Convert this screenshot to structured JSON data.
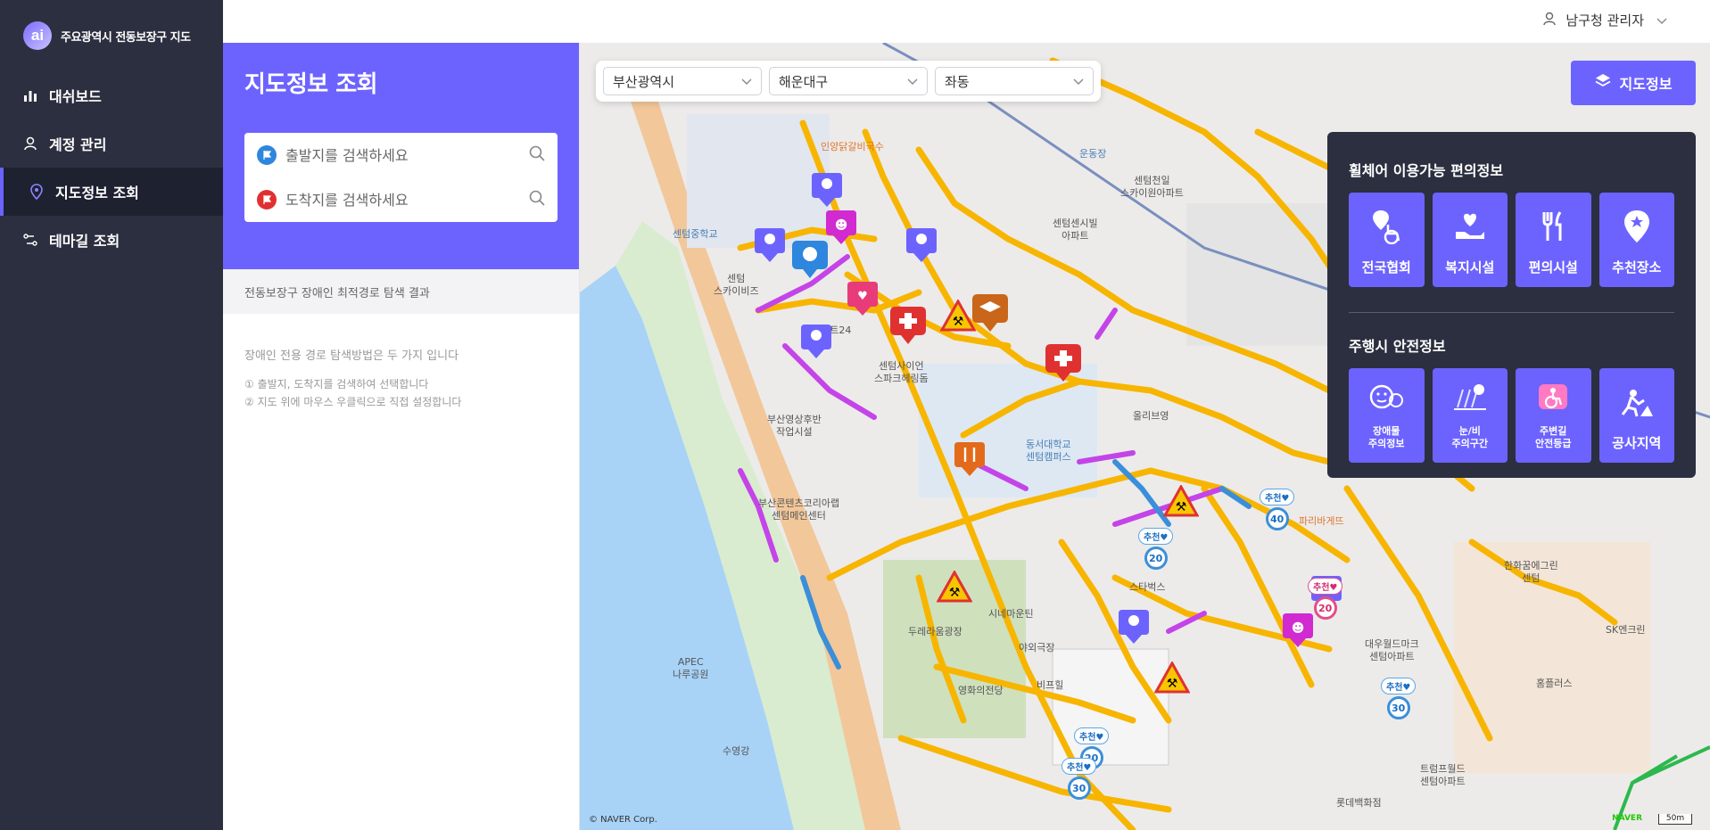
{
  "app": {
    "title": "주요광역시 전동보장구 지도",
    "logo_text": "ai"
  },
  "sidebar": {
    "items": [
      {
        "label": "대쉬보드",
        "icon": "bar-chart-icon"
      },
      {
        "label": "계정 관리",
        "icon": "user-icon"
      },
      {
        "label": "지도정보 조회",
        "icon": "map-pin-icon",
        "active": true
      },
      {
        "label": "테마길 조회",
        "icon": "route-icon"
      }
    ]
  },
  "header": {
    "user_name": "남구청 관리자"
  },
  "panel": {
    "title": "지도정보 조회",
    "start_placeholder": "출발지를 검색하세요",
    "end_placeholder": "도착지를 검색하세요",
    "result_title": "전동보장구 장애인 최적경로 탐색 결과",
    "guide_title": "장애인 전용 경로 탐색방법은 두 가지 입니다",
    "guide_1": "① 출발지, 도착지를 검색하여 선택합니다",
    "guide_2": "② 지도 위에 마우스 우클릭으로 직접 설정합니다"
  },
  "map": {
    "selectors": {
      "city": "부산광역시",
      "district": "해운대구",
      "dong": "좌동"
    },
    "map_info_button": "지도정보",
    "layers": {
      "convenience_title": "휠체어 이용가능 편의정보",
      "convenience": [
        {
          "label": "전국협회",
          "icon": "wheelchair-pin-icon"
        },
        {
          "label": "복지시설",
          "icon": "hand-heart-icon"
        },
        {
          "label": "편의시설",
          "icon": "fork-knife-icon"
        },
        {
          "label": "추천장소",
          "icon": "star-pin-icon"
        }
      ],
      "safety_title": "주행시 안전정보",
      "safety": [
        {
          "label": "장애물\n주의정보",
          "icon": "obstacle-face-icon"
        },
        {
          "label": "눈/비\n주의구간",
          "icon": "weather-icon"
        },
        {
          "label": "주변길\n안전등급",
          "icon": "wheelchair-grade-icon"
        },
        {
          "label": "공사지역",
          "icon": "construction-icon"
        }
      ]
    },
    "recommend_tag": "추천♥",
    "recommends": [
      "20",
      "40",
      "20",
      "30",
      "20",
      "30"
    ],
    "labels": {
      "a": "센텀중학교",
      "b": "센텀\n스카이비즈",
      "c": "이마트24",
      "d": "센텀사이언\n스파크헤링돔",
      "e": "부산영상후반\n작업시설",
      "f": "부산콘텐츠코리아랩\n센텀메인센터",
      "g": "동서대학교\n센텀캠퍼스",
      "h": "두레라움광장",
      "i": "시네마운틴",
      "j": "야외극장",
      "k": "영화의전당",
      "l": "비프힐",
      "m": "APEC\n나루공원",
      "n": "수영강",
      "o": "올리브영",
      "p": "스타벅스",
      "q": "대우월드마크\n센텀아파트",
      "r": "한화꿈에그린\n센텀",
      "s": "트럼프월드\n센텀아파트",
      "t": "롯데백화점",
      "u": "홈플러스",
      "v": "센텀천일\n스카이원아파트",
      "w": "운동장",
      "x": "센텀센시빌\n아파트",
      "y": "인양닭갈비국수",
      "z": "파리바게뜨",
      "aa": "SK엔크린"
    },
    "copyright": "© NAVER Corp.",
    "naver": "NAVER",
    "scale": "50m"
  },
  "colors": {
    "accent": "#6c63ff",
    "sidebar": "#2c2f3f",
    "road_yellow": "#f7b500",
    "road_purple": "#c444e8",
    "road_blue": "#3b8fd9"
  }
}
